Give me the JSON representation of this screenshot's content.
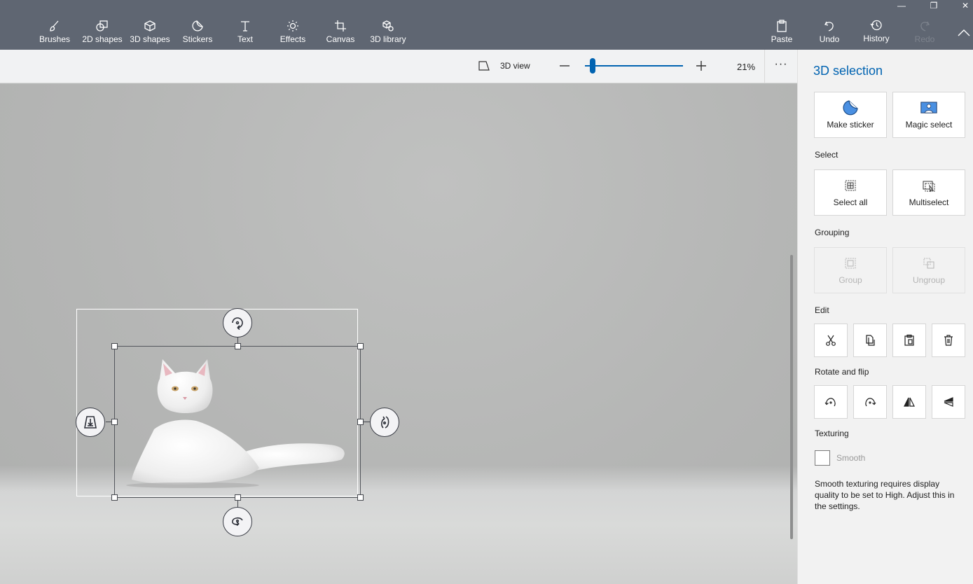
{
  "toolbar": {
    "tools": [
      {
        "label": "Brushes",
        "icon": "brush-icon"
      },
      {
        "label": "2D shapes",
        "icon": "2d-shapes-icon"
      },
      {
        "label": "3D shapes",
        "icon": "3d-shapes-icon"
      },
      {
        "label": "Stickers",
        "icon": "stickers-icon"
      },
      {
        "label": "Text",
        "icon": "text-icon"
      },
      {
        "label": "Effects",
        "icon": "effects-icon"
      },
      {
        "label": "Canvas",
        "icon": "canvas-icon"
      },
      {
        "label": "3D library",
        "icon": "3d-library-icon"
      }
    ],
    "actions": {
      "paste": "Paste",
      "undo": "Undo",
      "history": "History",
      "redo": "Redo"
    },
    "window_controls": {
      "minimize": "—",
      "restore": "❐",
      "close": "✕"
    }
  },
  "subbar": {
    "view_3d_label": "3D view",
    "zoom_percent": "21%",
    "zoom_minus": "—",
    "zoom_plus": "+",
    "more": "···"
  },
  "panel": {
    "title": "3D selection",
    "make_sticker": "Make sticker",
    "magic_select": "Magic select",
    "select_section": "Select",
    "select_all": "Select all",
    "multiselect": "Multiselect",
    "grouping_section": "Grouping",
    "group": "Group",
    "ungroup": "Ungroup",
    "edit_section": "Edit",
    "rotate_flip_section": "Rotate and flip",
    "texturing_section": "Texturing",
    "smooth": "Smooth",
    "smooth_checked": false,
    "smooth_note": "Smooth texturing requires display quality to be set to High. Adjust this in the settings."
  },
  "colors": {
    "accent": "#0063b1",
    "toolbar_bg": "#5f6672",
    "panel_bg": "#f2f2f2"
  }
}
